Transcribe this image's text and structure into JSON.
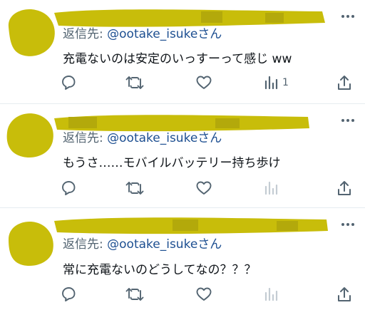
{
  "replies": [
    {
      "reply_to_prefix": "返信先:",
      "handle": "@ootake_isuke",
      "handle_suffix": "さん",
      "text": "充電ないのは安定のいっすーって感じ ww",
      "views_count": "1",
      "views_active": true
    },
    {
      "reply_to_prefix": "返信先:",
      "handle": "@ootake_isuke",
      "handle_suffix": "さん",
      "text": "もうさ……モバイルバッテリー持ち歩け",
      "views_count": "",
      "views_active": false
    },
    {
      "reply_to_prefix": "返信先:",
      "handle": "@ootake_isuke",
      "handle_suffix": "さん",
      "text": "常に充電ないのどうしてなの？？？",
      "views_count": "",
      "views_active": false
    }
  ],
  "colors": {
    "scribble": "#c8bd0a",
    "icon": "#536471",
    "icon_disabled": "#c4ccd3",
    "link": "#1d4f91"
  }
}
